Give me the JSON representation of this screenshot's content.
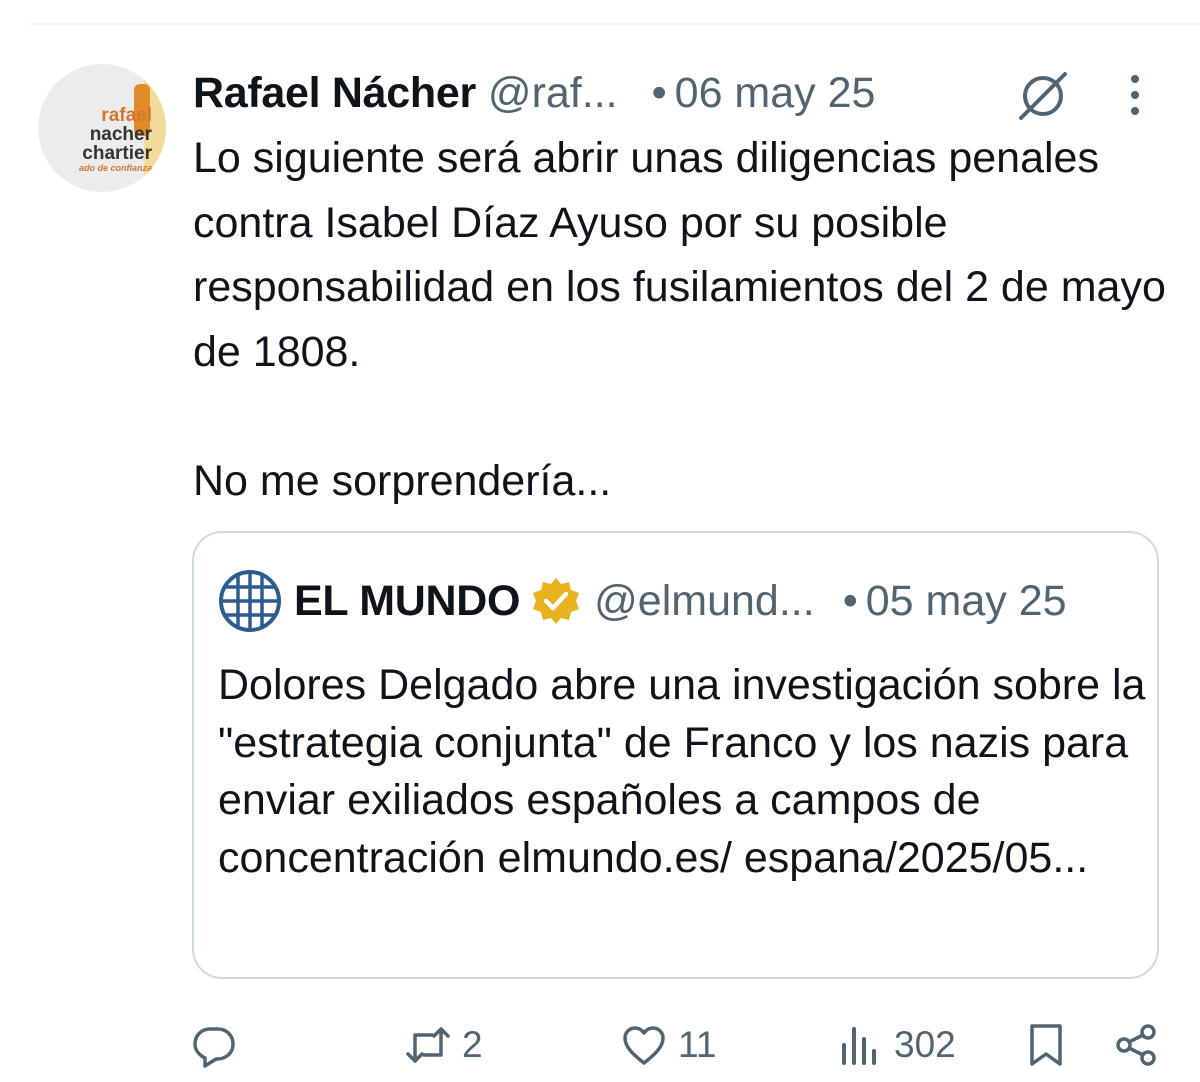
{
  "tweet": {
    "author_name": "Rafael Nácher",
    "author_handle": "@raf...",
    "separator": "•",
    "date": "06 may 25",
    "avatar_lines": [
      "rafael",
      "nacher",
      "chartier",
      "ado de confianza"
    ],
    "text_paragraphs": [
      "Lo siguiente será abrir unas diligencias penales contra Isabel Díaz Ayuso por su posible responsabilidad en los fusilamientos del 2 de mayo de 1808.",
      "No me sorprendería..."
    ]
  },
  "quoted_tweet": {
    "author_name": "EL MUNDO",
    "verified": true,
    "author_handle": "@elmund...",
    "separator": "•",
    "date": "05 may 25",
    "text": "Dolores Delgado abre una investigación sobre la \"estrategia conjunta\" de Franco y los nazis para enviar exiliados españoles a campos de concentración elmundo.es/ espana/2025/05..."
  },
  "actions": {
    "reply": {
      "icon": "reply-icon",
      "count": ""
    },
    "retweet": {
      "icon": "retweet-icon",
      "count": "2"
    },
    "like": {
      "icon": "heart-icon",
      "count": "11"
    },
    "views": {
      "icon": "views-icon",
      "count": "302"
    },
    "bookmark": {
      "icon": "bookmark-icon",
      "count": ""
    },
    "share": {
      "icon": "share-icon",
      "count": ""
    }
  },
  "colors": {
    "text": "#0f1419",
    "secondary": "#536471",
    "border": "#cfd9de",
    "verified_gold": "#e8b21f"
  }
}
